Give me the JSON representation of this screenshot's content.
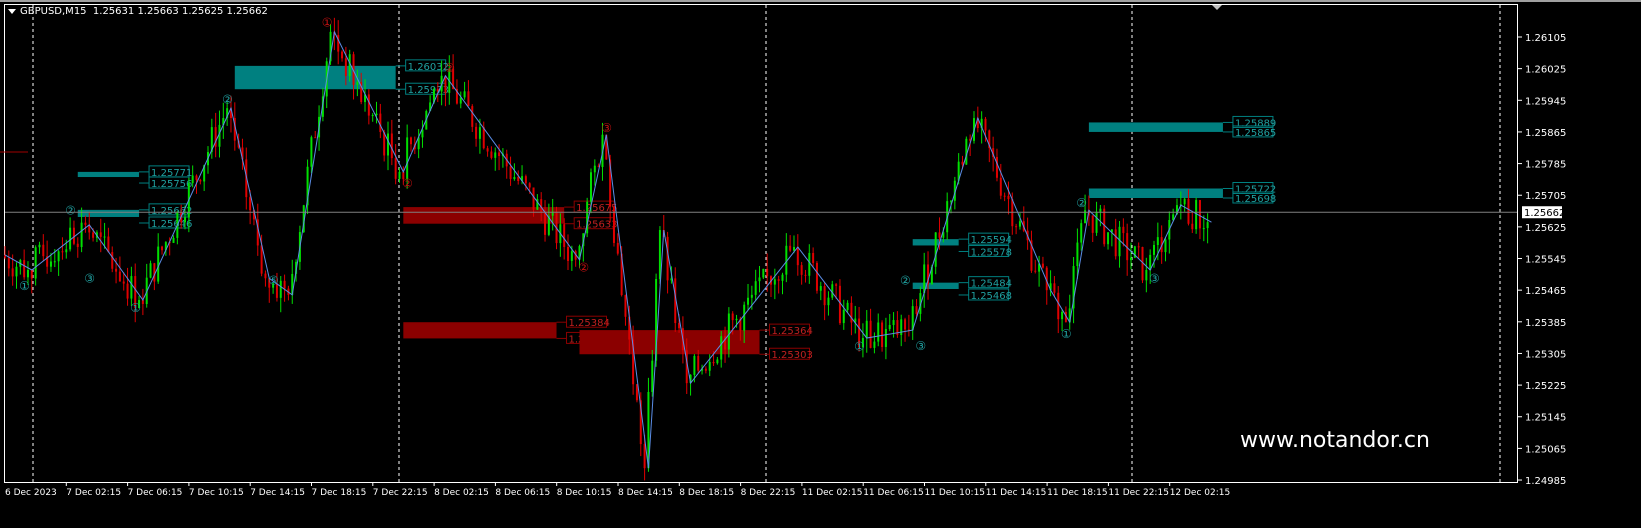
{
  "header": {
    "symbol": "GBPUSD,M15",
    "ohlc": "1.25631 1.25663 1.25625 1.25662"
  },
  "watermark": "www.notandor.cn",
  "colors": {
    "background": "#000000",
    "bull": "#00e000",
    "bear": "#e00000",
    "zigzag": "#5b8de6",
    "supply_zone": "#8b0000",
    "demand_zone": "#008080",
    "grid": "#ffffff",
    "price_line": "#808080"
  },
  "chart_data": {
    "type": "candlestick",
    "symbol": "GBPUSD",
    "timeframe": "M15",
    "ylim": [
      1.24985,
      1.26145
    ],
    "y_ticks": [
      "1.26105",
      "1.26025",
      "1.25945",
      "1.25865",
      "1.25785",
      "1.25705",
      "1.25625",
      "1.25545",
      "1.25465",
      "1.25385",
      "1.25305",
      "1.25225",
      "1.25145",
      "1.25065",
      "1.24985"
    ],
    "x_ticks": [
      "6 Dec 2023",
      "7 Dec 02:15",
      "7 Dec 06:15",
      "7 Dec 10:15",
      "7 Dec 14:15",
      "7 Dec 18:15",
      "7 Dec 22:15",
      "8 Dec 02:15",
      "8 Dec 06:15",
      "8 Dec 10:15",
      "8 Dec 14:15",
      "8 Dec 18:15",
      "8 Dec 22:15",
      "11 Dec 02:15",
      "11 Dec 06:15",
      "11 Dec 10:15",
      "11 Dec 14:15",
      "11 Dec 18:15",
      "11 Dec 22:15",
      "12 Dec 02:15"
    ],
    "current_price": "1.25662",
    "pivots": [
      {
        "bar": 0,
        "price": 1.25554
      },
      {
        "bar": 7,
        "price": 1.25516
      },
      {
        "bar": 22,
        "price": 1.2563
      },
      {
        "bar": 36,
        "price": 1.2544
      },
      {
        "bar": 59,
        "price": 1.25925
      },
      {
        "bar": 69,
        "price": 1.25495
      },
      {
        "bar": 75,
        "price": 1.25453
      },
      {
        "bar": 86,
        "price": 1.26118
      },
      {
        "bar": 104,
        "price": 1.25764
      },
      {
        "bar": 115,
        "price": 1.26007
      },
      {
        "bar": 150,
        "price": 1.25542
      },
      {
        "bar": 157,
        "price": 1.25858
      },
      {
        "bar": 168,
        "price": 1.25015
      },
      {
        "bar": 172,
        "price": 1.25617
      },
      {
        "bar": 179,
        "price": 1.2523
      },
      {
        "bar": 207,
        "price": 1.25574
      },
      {
        "bar": 225,
        "price": 1.25344
      },
      {
        "bar": 237,
        "price": 1.25364
      },
      {
        "bar": 254,
        "price": 1.259
      },
      {
        "bar": 273,
        "price": 1.25465
      },
      {
        "bar": 278,
        "price": 1.25384
      },
      {
        "bar": 283,
        "price": 1.25667
      },
      {
        "bar": 299,
        "price": 1.25516
      },
      {
        "bar": 307,
        "price": 1.2568
      },
      {
        "bar": 315,
        "price": 1.25637
      }
    ],
    "zones": [
      {
        "kind": "demand",
        "start": 19,
        "end": 35,
        "top": 1.25764,
        "bottom": 1.25751,
        "labels": [
          "1.25771",
          "1.25756"
        ]
      },
      {
        "kind": "demand",
        "start": 19,
        "end": 35,
        "top": 1.25668,
        "bottom": 1.2565,
        "labels": [
          "1.25662",
          "1.25646"
        ]
      },
      {
        "kind": "demand",
        "start": 60,
        "end": 102,
        "top": 1.26032,
        "bottom": 1.25973,
        "labels": [
          "1.26032",
          "1.25973"
        ]
      },
      {
        "kind": "supply",
        "start": 104,
        "end": 146,
        "top": 1.25675,
        "bottom": 1.25633,
        "labels": [
          "1.25675",
          "1.25633"
        ]
      },
      {
        "kind": "supply",
        "start": 104,
        "end": 144,
        "top": 1.25384,
        "bottom": 1.25343,
        "labels": [
          "1.25384",
          "1.25343"
        ]
      },
      {
        "kind": "supply",
        "start": 150,
        "end": 197,
        "top": 1.25364,
        "bottom": 1.25303,
        "labels": [
          "1.25364",
          "1.25303"
        ]
      },
      {
        "kind": "demand",
        "start": 237,
        "end": 249,
        "top": 1.25594,
        "bottom": 1.25578,
        "labels": [
          "1.25594",
          "1.25578"
        ]
      },
      {
        "kind": "demand",
        "start": 237,
        "end": 249,
        "top": 1.25484,
        "bottom": 1.25468,
        "labels": [
          "1.25484",
          "1.25468"
        ]
      },
      {
        "kind": "demand",
        "start": 283,
        "end": 318,
        "top": 1.25889,
        "bottom": 1.25865,
        "labels": [
          "1.25889",
          "1.25865"
        ]
      },
      {
        "kind": "demand",
        "start": 283,
        "end": 318,
        "top": 1.25722,
        "bottom": 1.25698,
        "labels": [
          "1.25722",
          "1.25698"
        ]
      }
    ],
    "wave_labels": [
      {
        "bar": 5,
        "price": 1.25475,
        "text": "①",
        "color": "teal"
      },
      {
        "bar": 17,
        "price": 1.25667,
        "text": "②",
        "color": "teal"
      },
      {
        "bar": 22,
        "price": 1.25495,
        "text": "③",
        "color": "teal"
      },
      {
        "bar": 34,
        "price": 1.2542,
        "text": "①",
        "color": "teal"
      },
      {
        "bar": 58,
        "price": 1.25947,
        "text": "②",
        "color": "teal"
      },
      {
        "bar": 70,
        "price": 1.2549,
        "text": "⑤",
        "color": "teal"
      },
      {
        "bar": 84,
        "price": 1.26142,
        "text": "①",
        "color": "red"
      },
      {
        "bar": 116,
        "price": 1.26027,
        "text": "②",
        "color": "red"
      },
      {
        "bar": 105,
        "price": 1.25735,
        "text": "②",
        "color": "red"
      },
      {
        "bar": 157,
        "price": 1.25875,
        "text": "③",
        "color": "red"
      },
      {
        "bar": 151,
        "price": 1.25522,
        "text": "②",
        "color": "red"
      },
      {
        "bar": 223,
        "price": 1.25322,
        "text": "①",
        "color": "teal"
      },
      {
        "bar": 235,
        "price": 1.2549,
        "text": "②",
        "color": "teal"
      },
      {
        "bar": 239,
        "price": 1.25324,
        "text": "③",
        "color": "teal"
      },
      {
        "bar": 277,
        "price": 1.25354,
        "text": "①",
        "color": "teal"
      },
      {
        "bar": 281,
        "price": 1.25685,
        "text": "②",
        "color": "teal"
      },
      {
        "bar": 300,
        "price": 1.25495,
        "text": "③",
        "color": "teal"
      }
    ]
  }
}
